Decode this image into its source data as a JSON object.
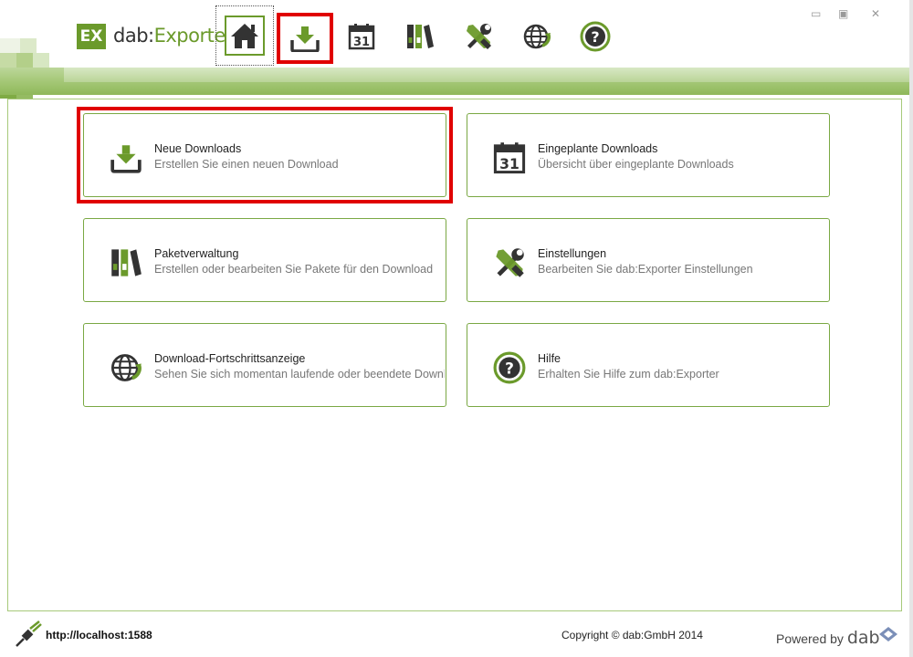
{
  "app": {
    "logo_badge": "EX",
    "logo_name": "dab",
    "logo_suffix": "Exporter",
    "brand_color": "#6b9a2b",
    "highlight_color": "#e00000"
  },
  "toolbar": {
    "items": [
      {
        "name": "home",
        "icon": "home-icon",
        "state": "current"
      },
      {
        "name": "new-download",
        "icon": "download-icon",
        "state": "highlighted"
      },
      {
        "name": "scheduled",
        "icon": "calendar-icon",
        "label": "31"
      },
      {
        "name": "packages",
        "icon": "binders-icon"
      },
      {
        "name": "settings",
        "icon": "tools-icon"
      },
      {
        "name": "progress",
        "icon": "globe-icon"
      },
      {
        "name": "help",
        "icon": "help-icon",
        "label": "?"
      }
    ]
  },
  "window_controls": {
    "minimize": "▭",
    "restore": "▣",
    "close": "✕"
  },
  "cards": [
    {
      "title": "Neue Downloads",
      "subtitle": "Erstellen Sie einen neuen Download",
      "icon": "download-icon"
    },
    {
      "title": "Eingeplante Downloads",
      "subtitle": "Übersicht über eingeplante Downloads",
      "icon": "calendar-icon",
      "icon_label": "31"
    },
    {
      "title": "Paketverwaltung",
      "subtitle": "Erstellen oder bearbeiten Sie Pakete für den Download",
      "icon": "binders-icon"
    },
    {
      "title": "Einstellungen",
      "subtitle": "Bearbeiten Sie dab:Exporter Einstellungen",
      "icon": "tools-icon"
    },
    {
      "title": "Download-Fortschrittsanzeige",
      "subtitle": "Sehen Sie sich momentan laufende oder beendete Downloads an",
      "icon": "globe-icon"
    },
    {
      "title": "Hilfe",
      "subtitle": "Erhalten Sie Hilfe zum dab:Exporter",
      "icon": "help-icon",
      "icon_label": "?"
    }
  ],
  "footer": {
    "server_url": "http://localhost:1588",
    "copyright": "Copyright © dab:GmbH 2014",
    "powered_by": "Powered by",
    "powered_brand": "dab"
  }
}
